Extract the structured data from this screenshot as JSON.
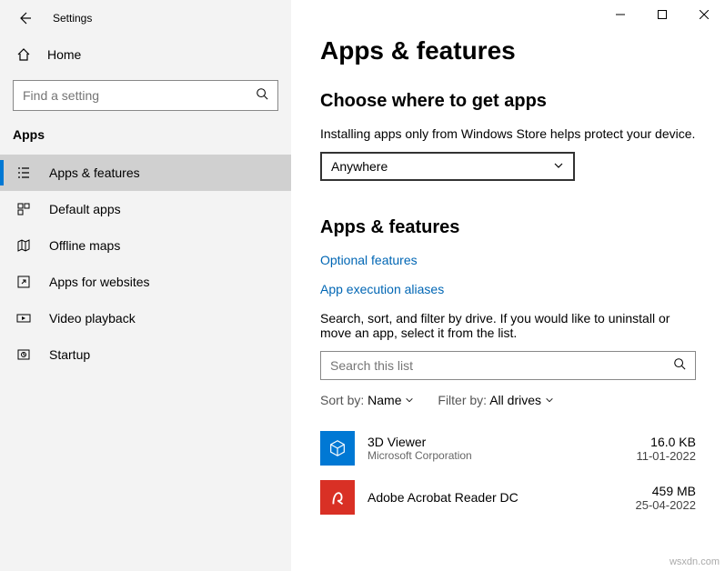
{
  "titlebar": {
    "title": "Settings"
  },
  "sidebar": {
    "home": "Home",
    "search_placeholder": "Find a setting",
    "category": "Apps",
    "items": [
      {
        "label": "Apps & features"
      },
      {
        "label": "Default apps"
      },
      {
        "label": "Offline maps"
      },
      {
        "label": "Apps for websites"
      },
      {
        "label": "Video playback"
      },
      {
        "label": "Startup"
      }
    ]
  },
  "main": {
    "h1": "Apps & features",
    "section1": {
      "heading": "Choose where to get apps",
      "desc": "Installing apps only from Windows Store helps protect your device.",
      "dropdown_value": "Anywhere"
    },
    "section2": {
      "heading": "Apps & features",
      "link1": "Optional features",
      "link2": "App execution aliases",
      "desc": "Search, sort, and filter by drive. If you would like to uninstall or move an app, select it from the list.",
      "search_placeholder": "Search this list",
      "sort_label": "Sort by:",
      "sort_value": "Name",
      "filter_label": "Filter by:",
      "filter_value": "All drives"
    },
    "apps": [
      {
        "name": "3D Viewer",
        "publisher": "Microsoft Corporation",
        "size": "16.0 KB",
        "date": "11-01-2022",
        "color": "#0078d4"
      },
      {
        "name": "Adobe Acrobat Reader DC",
        "publisher": "",
        "size": "459 MB",
        "date": "25-04-2022",
        "color": "#d93025"
      }
    ]
  },
  "watermark": "wsxdn.com"
}
